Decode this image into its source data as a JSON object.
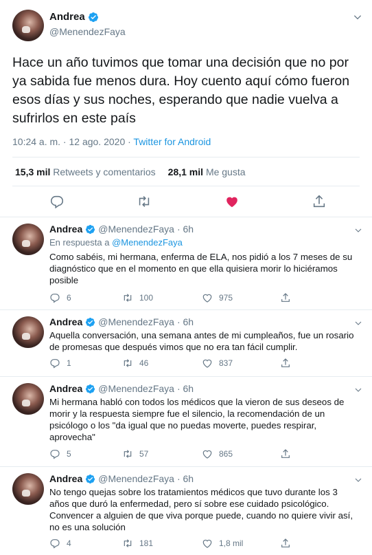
{
  "main_tweet": {
    "author_name": "Andrea",
    "author_handle": "@MenendezFaya",
    "text": "Hace un año tuvimos que tomar una decisión que no por ya sabida fue menos dura. Hoy cuento aquí cómo fueron esos días y sus noches, esperando que nadie vuelva a sufrirlos en este país",
    "timestamp": "10:24 a. m. · 12 ago. 2020 · ",
    "source": "Twitter for Android",
    "retweets_count": "15,3 mil",
    "retweets_label": "Retweets y comentarios",
    "likes_count": "28,1 mil",
    "likes_label": "Me gusta"
  },
  "replies": [
    {
      "author_name": "Andrea",
      "author_handle": "@MenendezFaya",
      "time": "· 6h",
      "in_reply_prefix": "En respuesta a ",
      "in_reply_mention": "@MenendezFaya",
      "text": "Como sabéis, mi hermana, enferma de ELA, nos pidió a los 7 meses de su diagnóstico que en el momento en que ella quisiera morir lo hiciéramos posible",
      "reply_count": "6",
      "retweet_count": "100",
      "like_count": "975"
    },
    {
      "author_name": "Andrea",
      "author_handle": "@MenendezFaya",
      "time": "· 6h",
      "text": "Aquella conversación, una semana antes de mi cumpleaños, fue un rosario de promesas que después vimos que no era tan fácil cumplir.",
      "reply_count": "1",
      "retweet_count": "46",
      "like_count": "837"
    },
    {
      "author_name": "Andrea",
      "author_handle": "@MenendezFaya",
      "time": "· 6h",
      "text": "Mi hermana habló con todos los médicos que la vieron de sus deseos de morir y la respuesta siempre fue el silencio, la recomendación de un psicólogo o los \"da igual que no puedas moverte, puedes respirar, aprovecha\"",
      "reply_count": "5",
      "retweet_count": "57",
      "like_count": "865"
    },
    {
      "author_name": "Andrea",
      "author_handle": "@MenendezFaya",
      "time": "· 6h",
      "text": "No tengo quejas sobre los tratamientos médicos que tuvo durante los 3 años que duró la enfermedad, pero sí sobre ese cuidado psicológico. Convencer a alguien de que viva porque puede, cuando no quiere vivir así, no es una solución",
      "reply_count": "4",
      "retweet_count": "181",
      "like_count": "1,8 mil"
    }
  ],
  "icons": {
    "verified": "verified-badge-icon",
    "chevron": "chevron-down-icon",
    "reply": "reply-icon",
    "retweet": "retweet-icon",
    "like": "heart-icon",
    "share": "share-icon"
  },
  "colors": {
    "accent": "#1b95e0",
    "muted_text": "#657786",
    "like_active": "#e0245e",
    "border": "#e6ecf0"
  }
}
